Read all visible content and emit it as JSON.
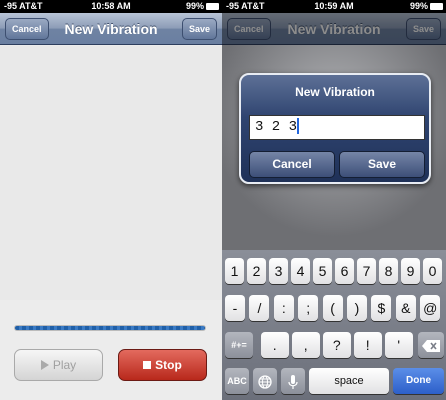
{
  "left": {
    "status": {
      "carrier": "-95 AT&T",
      "time": "10:58 AM",
      "battery": "99%"
    },
    "nav": {
      "cancel": "Cancel",
      "title": "New Vibration",
      "save": "Save"
    },
    "buttons": {
      "play": "Play",
      "stop": "Stop"
    }
  },
  "right": {
    "status": {
      "carrier": "-95 AT&T",
      "time": "10:59 AM",
      "battery": "99%"
    },
    "nav": {
      "cancel": "Cancel",
      "title": "New Vibration",
      "save": "Save"
    },
    "alert": {
      "title": "New Vibration",
      "value": "3 2 3",
      "cancel": "Cancel",
      "save": "Save"
    },
    "keyboard": {
      "row1": [
        "1",
        "2",
        "3",
        "4",
        "5",
        "6",
        "7",
        "8",
        "9",
        "0"
      ],
      "row2": [
        "-",
        "/",
        ":",
        ";",
        "(",
        ")",
        "$",
        "&",
        "@"
      ],
      "row3": [
        ".",
        ",",
        "?",
        "!",
        "'"
      ],
      "toggle": "#+=",
      "abc": "ABC",
      "space": "space",
      "done": "Done"
    }
  }
}
